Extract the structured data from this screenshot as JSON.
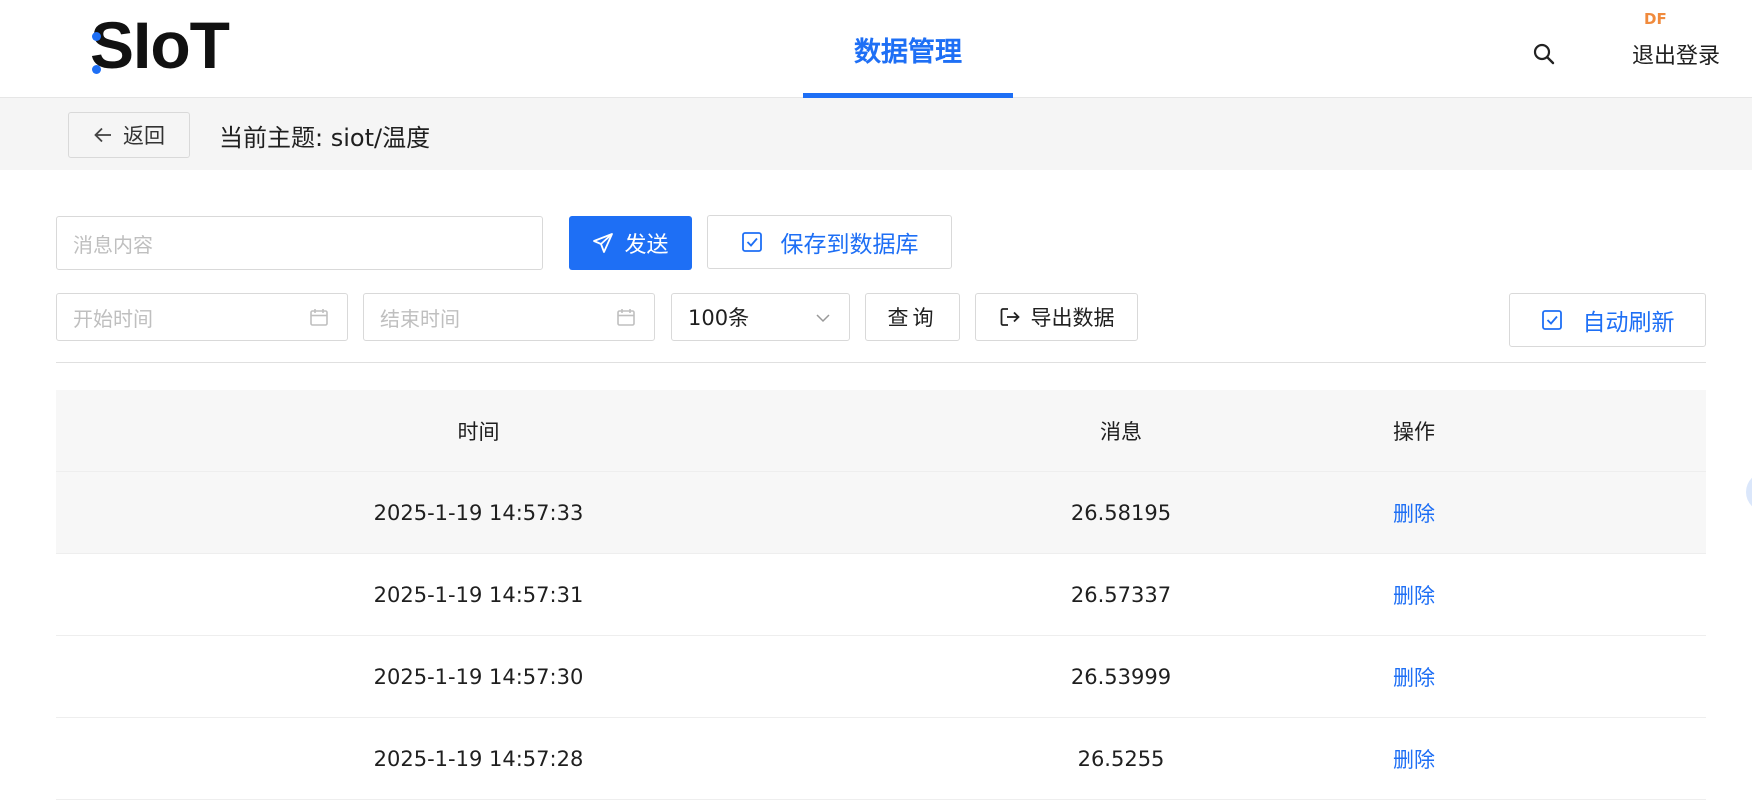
{
  "header": {
    "logo": "SIoT",
    "nav_tab": "数据管理",
    "badge": "DF",
    "logout": "退出登录"
  },
  "subbar": {
    "back_label": "返回",
    "topic": "当前主题: siot/温度"
  },
  "controls": {
    "message_placeholder": "消息内容",
    "send_label": "发送",
    "save_label": "保存到数据库",
    "start_placeholder": "开始时间",
    "end_placeholder": "结束时间",
    "limit_value": "100条",
    "query_label": "查询",
    "export_label": "导出数据",
    "auto_refresh_label": "自动刷新"
  },
  "table": {
    "columns": [
      "时间",
      "消息",
      "操作"
    ],
    "rows": [
      {
        "time": "2025-1-19 14:57:33",
        "message": "26.58195",
        "action": "删除"
      },
      {
        "time": "2025-1-19 14:57:31",
        "message": "26.57337",
        "action": "删除"
      },
      {
        "time": "2025-1-19 14:57:30",
        "message": "26.53999",
        "action": "删除"
      },
      {
        "time": "2025-1-19 14:57:28",
        "message": "26.5255",
        "action": "删除"
      }
    ]
  },
  "colors": {
    "accent": "#1e6ff5",
    "badge": "#f08a3c"
  }
}
